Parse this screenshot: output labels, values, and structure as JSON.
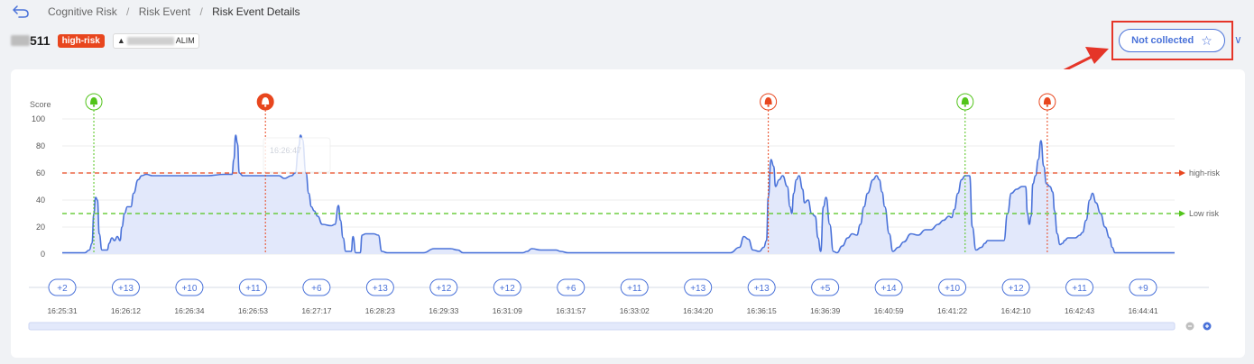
{
  "breadcrumb": {
    "items": [
      "Cognitive Risk",
      "Risk Event",
      "Risk Event Details"
    ],
    "separator": "/"
  },
  "event": {
    "id_suffix": "511",
    "risk_badge": "high-risk",
    "tag_suffix": "ALIM"
  },
  "collect_button": {
    "label": "Not collected",
    "icon": "star-outline-icon"
  },
  "colors": {
    "accent": "#4a72d9",
    "high_risk": "#e8461e",
    "low_risk": "#52c41a",
    "highlight": "#e53528",
    "area_fill": "#dfe5fb"
  },
  "chart_data": {
    "type": "area",
    "ylabel": "Score",
    "ylim": [
      0,
      100
    ],
    "yticks": [
      0,
      20,
      40,
      60,
      80,
      100
    ],
    "thresholds": [
      {
        "name": "high-risk",
        "value": 60
      },
      {
        "name": "Low risk",
        "value": 30
      }
    ],
    "series": [
      {
        "points": [
          [
            0,
            1
          ],
          [
            25,
            1
          ],
          [
            30,
            3
          ],
          [
            33,
            8
          ],
          [
            35,
            30
          ],
          [
            37,
            42
          ],
          [
            39,
            40
          ],
          [
            41,
            15
          ],
          [
            44,
            3
          ],
          [
            50,
            3
          ],
          [
            52,
            8
          ],
          [
            55,
            12
          ],
          [
            58,
            10
          ],
          [
            61,
            13
          ],
          [
            64,
            10
          ],
          [
            66,
            20
          ],
          [
            69,
            30
          ],
          [
            72,
            35
          ],
          [
            76,
            35
          ],
          [
            79,
            45
          ],
          [
            84,
            55
          ],
          [
            88,
            58
          ],
          [
            93,
            59
          ],
          [
            100,
            58
          ],
          [
            120,
            58
          ],
          [
            160,
            58
          ],
          [
            180,
            59
          ],
          [
            188,
            59
          ],
          [
            190,
            70
          ],
          [
            192,
            88
          ],
          [
            194,
            82
          ],
          [
            196,
            60
          ],
          [
            200,
            58
          ],
          [
            240,
            58
          ],
          [
            246,
            56
          ],
          [
            254,
            58
          ],
          [
            258,
            60
          ],
          [
            262,
            80
          ],
          [
            264,
            88
          ],
          [
            266,
            85
          ],
          [
            270,
            60
          ],
          [
            273,
            45
          ],
          [
            276,
            35
          ],
          [
            279,
            32
          ],
          [
            283,
            28
          ],
          [
            288,
            22
          ],
          [
            298,
            21
          ],
          [
            302,
            22
          ],
          [
            306,
            36
          ],
          [
            308,
            25
          ],
          [
            311,
            12
          ],
          [
            314,
            2
          ],
          [
            320,
            2
          ],
          [
            322,
            13
          ],
          [
            325,
            1
          ],
          [
            330,
            1
          ],
          [
            332,
            14
          ],
          [
            336,
            15
          ],
          [
            345,
            15
          ],
          [
            350,
            14
          ],
          [
            354,
            2
          ],
          [
            360,
            1
          ],
          [
            400,
            1
          ],
          [
            412,
            4
          ],
          [
            418,
            4
          ],
          [
            430,
            4
          ],
          [
            438,
            3
          ],
          [
            444,
            1
          ],
          [
            500,
            1
          ],
          [
            510,
            1
          ],
          [
            515,
            2
          ],
          [
            520,
            4
          ],
          [
            530,
            3
          ],
          [
            540,
            3
          ],
          [
            547,
            3
          ],
          [
            552,
            2
          ],
          [
            560,
            1
          ],
          [
            640,
            1
          ],
          [
            700,
            1
          ],
          [
            740,
            1
          ],
          [
            750,
            5
          ],
          [
            755,
            13
          ],
          [
            760,
            11
          ],
          [
            765,
            3
          ],
          [
            772,
            2
          ],
          [
            777,
            5
          ],
          [
            780,
            10
          ],
          [
            782,
            42
          ],
          [
            785,
            70
          ],
          [
            788,
            65
          ],
          [
            790,
            50
          ],
          [
            794,
            55
          ],
          [
            798,
            58
          ],
          [
            803,
            50
          ],
          [
            806,
            35
          ],
          [
            808,
            30
          ],
          [
            810,
            45
          ],
          [
            813,
            55
          ],
          [
            816,
            58
          ],
          [
            820,
            48
          ],
          [
            822,
            38
          ],
          [
            826,
            40
          ],
          [
            830,
            30
          ],
          [
            834,
            28
          ],
          [
            837,
            12
          ],
          [
            840,
            2
          ],
          [
            843,
            35
          ],
          [
            846,
            42
          ],
          [
            850,
            22
          ],
          [
            854,
            2
          ],
          [
            858,
            1
          ],
          [
            864,
            6
          ],
          [
            870,
            12
          ],
          [
            875,
            15
          ],
          [
            880,
            14
          ],
          [
            884,
            22
          ],
          [
            888,
            35
          ],
          [
            892,
            45
          ],
          [
            898,
            55
          ],
          [
            902,
            58
          ],
          [
            905,
            55
          ],
          [
            908,
            46
          ],
          [
            911,
            35
          ],
          [
            916,
            15
          ],
          [
            920,
            2
          ],
          [
            926,
            5
          ],
          [
            932,
            9
          ],
          [
            940,
            15
          ],
          [
            948,
            14
          ],
          [
            956,
            18
          ],
          [
            962,
            18
          ],
          [
            970,
            22
          ],
          [
            976,
            25
          ],
          [
            982,
            28
          ],
          [
            985,
            27
          ],
          [
            988,
            33
          ],
          [
            992,
            45
          ],
          [
            996,
            55
          ],
          [
            1000,
            58
          ],
          [
            1005,
            58
          ],
          [
            1008,
            20
          ],
          [
            1012,
            3
          ],
          [
            1018,
            5
          ],
          [
            1022,
            8
          ],
          [
            1025,
            10
          ],
          [
            1035,
            10
          ],
          [
            1043,
            10
          ],
          [
            1047,
            30
          ],
          [
            1051,
            45
          ],
          [
            1057,
            48
          ],
          [
            1063,
            50
          ],
          [
            1067,
            50
          ],
          [
            1069,
            30
          ],
          [
            1071,
            22
          ],
          [
            1073,
            28
          ],
          [
            1075,
            52
          ],
          [
            1078,
            58
          ],
          [
            1081,
            70
          ],
          [
            1084,
            84
          ],
          [
            1087,
            65
          ],
          [
            1090,
            52
          ],
          [
            1094,
            50
          ],
          [
            1097,
            46
          ],
          [
            1099,
            32
          ],
          [
            1102,
            15
          ],
          [
            1105,
            7
          ],
          [
            1108,
            8
          ],
          [
            1110,
            10
          ],
          [
            1114,
            12
          ],
          [
            1118,
            12
          ],
          [
            1122,
            12
          ],
          [
            1127,
            14
          ],
          [
            1130,
            16
          ],
          [
            1134,
            25
          ],
          [
            1138,
            40
          ],
          [
            1141,
            45
          ],
          [
            1145,
            38
          ],
          [
            1150,
            30
          ],
          [
            1155,
            20
          ],
          [
            1160,
            12
          ],
          [
            1163,
            5
          ],
          [
            1166,
            1
          ],
          [
            1232,
            1
          ]
        ]
      }
    ],
    "alerts": [
      {
        "x": 35,
        "level": "low"
      },
      {
        "x": 225,
        "level": "high",
        "filled": true
      },
      {
        "x": 782,
        "level": "high"
      },
      {
        "x": 1000,
        "level": "low"
      },
      {
        "x": 1091,
        "level": "high"
      }
    ],
    "hidden_tooltip": {
      "time": "16:26:47"
    },
    "timeline": {
      "counts": [
        "+2",
        "+13",
        "+10",
        "+11",
        "+6",
        "+13",
        "+12",
        "+12",
        "+6",
        "+11",
        "+13",
        "+13",
        "+5",
        "+14",
        "+10",
        "+12",
        "+11",
        "+9"
      ],
      "times": [
        "16:25:31",
        "16:26:12",
        "16:26:34",
        "16:26:53",
        "16:27:17",
        "16:28:23",
        "16:29:33",
        "16:31:09",
        "16:31:57",
        "16:33:02",
        "16:34:20",
        "16:36:15",
        "16:36:39",
        "16:40:59",
        "16:41:22",
        "16:42:10",
        "16:42:43",
        "16:44:41"
      ]
    },
    "zoom_controls": {
      "minus": "zoom-out-icon",
      "plus": "zoom-in-icon"
    },
    "grid": "horizontal",
    "legend": "right-end of threshold lines"
  }
}
